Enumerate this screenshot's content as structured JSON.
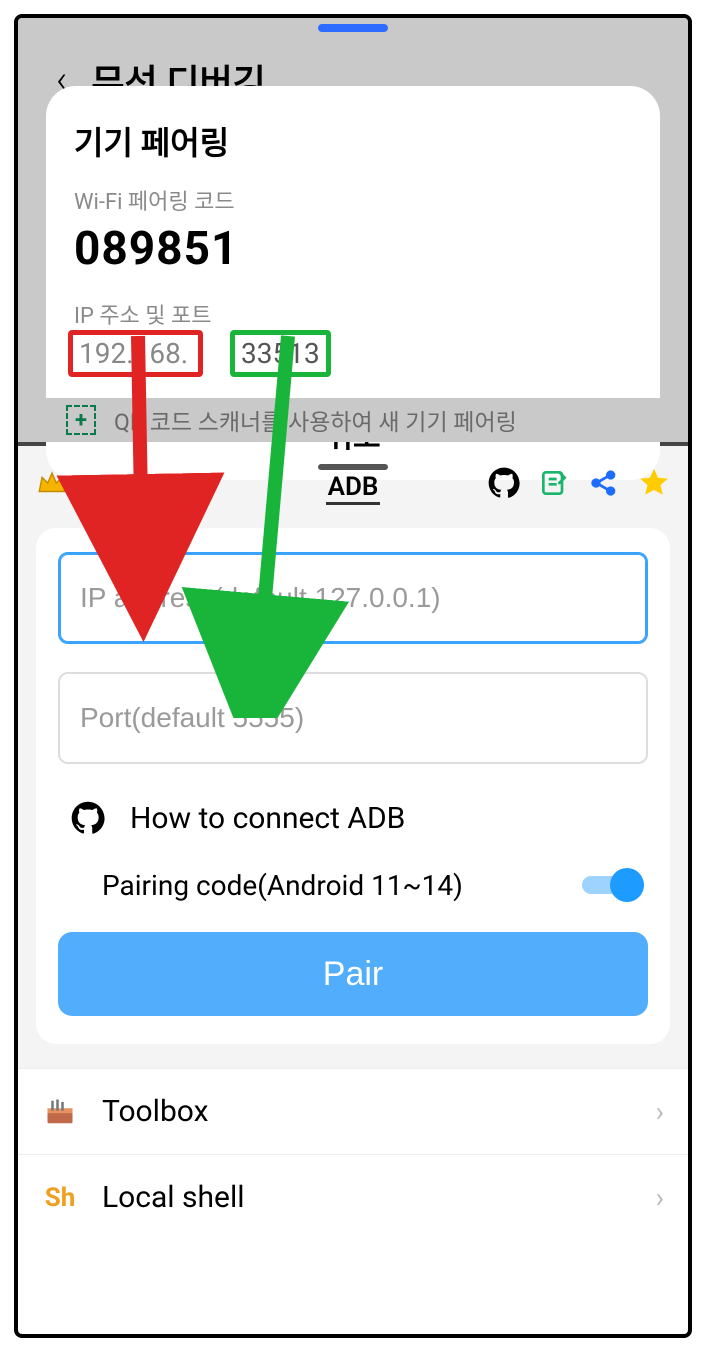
{
  "upper": {
    "settings_title": "무선 디버깅",
    "dialog": {
      "title": "기기 페어링",
      "code_label": "Wi-Fi 페어링 코드",
      "code": "089851",
      "ipport_label": "IP 주소 및 포트",
      "ip": "192.168.",
      "port": "33513",
      "cancel": "취소"
    },
    "qr_hint": "QR 코드 스캐너를 사용하여 새 기기 페어링"
  },
  "toolbar": {
    "center_label": "ADB"
  },
  "form": {
    "ip_placeholder": "IP address(default 127.0.0.1)",
    "port_placeholder": "Port(default 5555)",
    "howto": "How to connect ADB",
    "toggle_label": "Pairing code(Android 11~14)",
    "toggle_on": true,
    "pair_label": "Pair"
  },
  "list": {
    "toolbox": "Toolbox",
    "localshell": "Local shell",
    "sh_glyph": "Sh"
  },
  "colors": {
    "accent": "#52aefc",
    "red": "#e02424",
    "green": "#18b53a"
  }
}
